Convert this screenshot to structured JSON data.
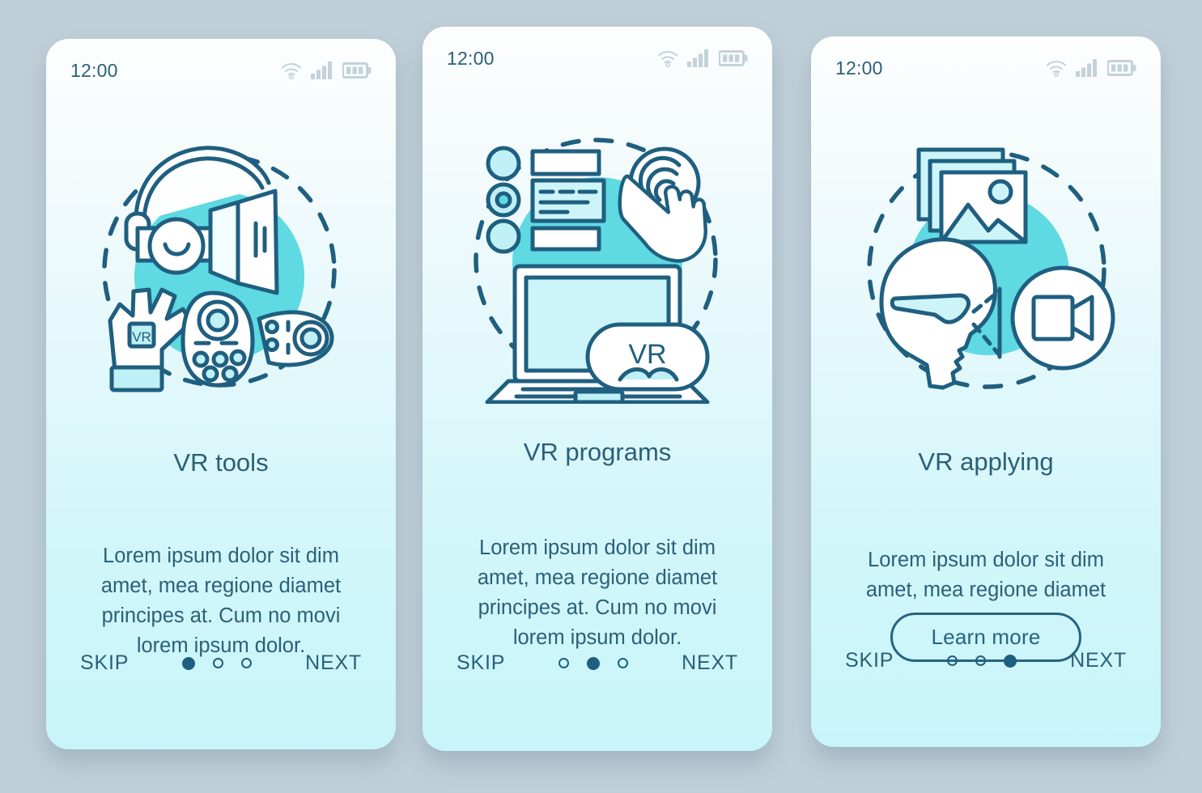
{
  "meta": {
    "background_color": "#bfcfd8",
    "stroke_color": "#1f5f80",
    "accent_cyan": "#5fd9e2",
    "text_color": "#2a5f78"
  },
  "screens": [
    {
      "status": {
        "time": "12:00",
        "icons": [
          "wifi-icon",
          "signal-icon",
          "battery-icon"
        ]
      },
      "illustration": "vr-tools-illustration",
      "illustration_label": "VR",
      "title": "VR tools",
      "body": "Lorem ipsum dolor sit dim amet, mea regione diamet principes at. Cum no movi lorem ipsum dolor.",
      "footer": {
        "skip": "SKIP",
        "next": "NEXT",
        "dots": 3,
        "active_dot": 0
      }
    },
    {
      "status": {
        "time": "12:00",
        "icons": [
          "wifi-icon",
          "signal-icon",
          "battery-icon"
        ]
      },
      "illustration": "vr-programs-illustration",
      "illustration_label": "VR",
      "title": "VR programs",
      "body": "Lorem ipsum dolor sit dim amet, mea regione diamet principes at. Cum no movi lorem ipsum dolor.",
      "footer": {
        "skip": "SKIP",
        "next": "NEXT",
        "dots": 3,
        "active_dot": 1
      }
    },
    {
      "status": {
        "time": "12:00",
        "icons": [
          "wifi-icon",
          "signal-icon",
          "battery-icon"
        ]
      },
      "illustration": "vr-applying-illustration",
      "title": "VR applying",
      "body": "Lorem ipsum dolor sit dim amet, mea regione diamet",
      "cta_label": "Learn more",
      "footer": {
        "skip": "SKIP",
        "next": "NEXT",
        "dots": 3,
        "active_dot": 2
      }
    }
  ]
}
